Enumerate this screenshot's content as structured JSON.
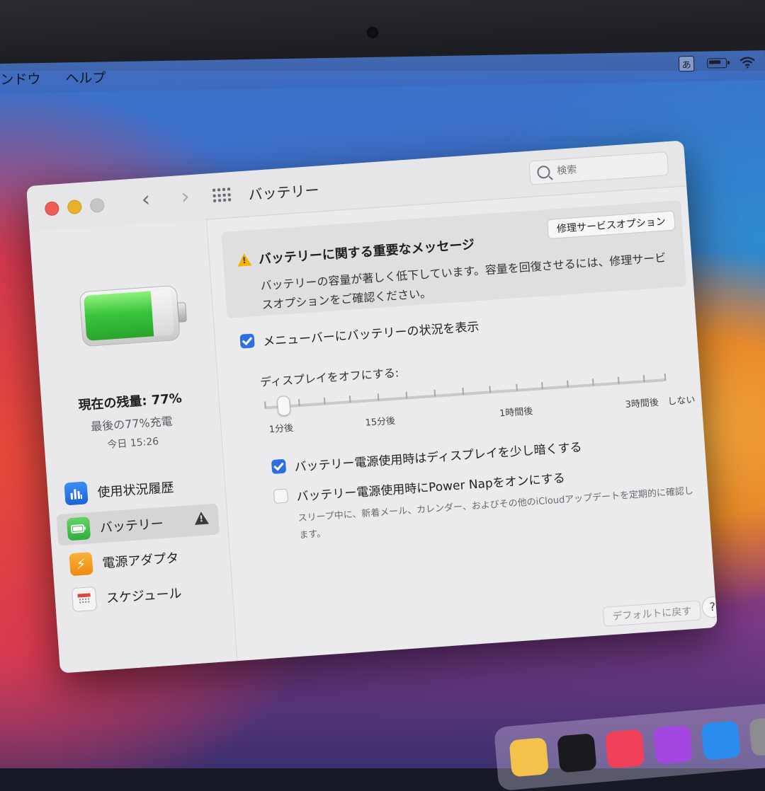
{
  "menubar": {
    "items": [
      "ンドウ",
      "ヘルプ"
    ],
    "input_source": "あ"
  },
  "window": {
    "title": "バッテリー",
    "search_placeholder": "検索"
  },
  "sidebar": {
    "charge_level_label": "現在の残量:",
    "charge_level_value": "77%",
    "charge_level_fraction": 0.77,
    "last_charge": "最後の77%充電",
    "charge_time": "今日 15:26",
    "items": [
      {
        "label": "使用状況履歴",
        "icon": "bar-chart-icon",
        "selected": false
      },
      {
        "label": "バッテリー",
        "icon": "battery-icon",
        "selected": true,
        "warning": true
      },
      {
        "label": "電源アダプタ",
        "icon": "lightning-icon",
        "selected": false
      },
      {
        "label": "スケジュール",
        "icon": "calendar-icon",
        "selected": false
      }
    ]
  },
  "alert": {
    "title": "バッテリーに関する重要なメッセージ",
    "body": "バッテリーの容量が著しく低下しています。容量を回復させるには、修理サービスオプションをご確認ください。",
    "button": "修理サービスオプション"
  },
  "settings": {
    "show_in_menubar": {
      "label": "メニューバーにバッテリーの状況を表示",
      "checked": true
    },
    "display_off": {
      "label": "ディスプレイをオフにする:",
      "tick_labels": [
        "1分後",
        "15分後",
        "1時間後",
        "3時間後",
        "しない"
      ],
      "value": "1分後"
    },
    "dim_display": {
      "label": "バッテリー電源使用時はディスプレイを少し暗くする",
      "checked": true
    },
    "power_nap": {
      "label": "バッテリー電源使用時にPower Napをオンにする",
      "checked": false,
      "description": "スリープ中に、新着メール、カレンダー、およびその他のiCloudアップデートを定期的に確認します。"
    }
  },
  "footer": {
    "restore_defaults": "デフォルトに戻す",
    "help": "?"
  },
  "colors": {
    "accent": "#2d6fe3",
    "battery_green": "#39c53b",
    "warning_yellow": "#f4b400"
  }
}
